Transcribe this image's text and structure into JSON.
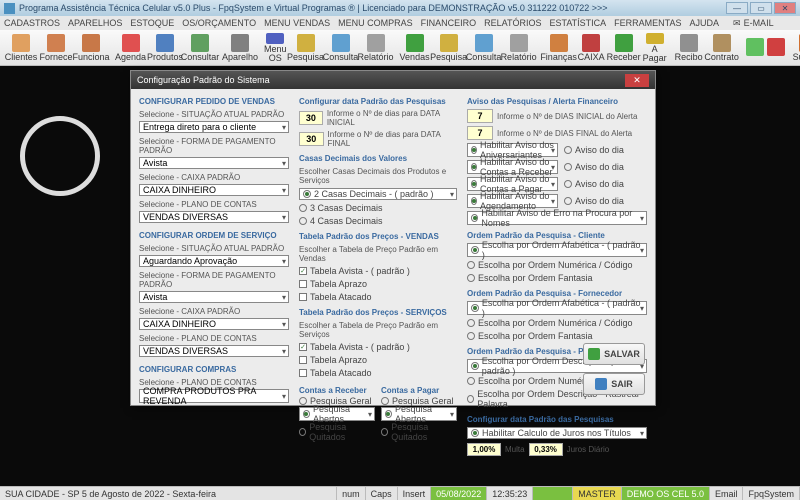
{
  "title": "Programa Assistência Técnica Celular v5.0 Plus - FpqSystem e Virtual Programas ® | Licenciado para  DEMONSTRAÇÃO v5.0 311222 010722 >>>",
  "menu": [
    "CADASTROS",
    "APARELHOS",
    "ESTOQUE",
    "OS/ORÇAMENTO",
    "MENU VENDAS",
    "MENU COMPRAS",
    "FINANCEIRO",
    "RELATÓRIOS",
    "ESTATÍSTICA",
    "FERRAMENTAS",
    "AJUDA"
  ],
  "email": "E-MAIL",
  "toolbar": [
    {
      "l": "Clientes",
      "c": "#e0a060"
    },
    {
      "l": "Fornece",
      "c": "#d08050"
    },
    {
      "l": "Funciona",
      "c": "#c87848"
    },
    {
      "l": "Agenda",
      "c": "#e05050"
    },
    {
      "l": "Produtos",
      "c": "#5080c0"
    },
    {
      "l": "Consultar",
      "c": "#60a060"
    },
    {
      "l": "Aparelho",
      "c": "#808080"
    },
    {
      "l": "Menu OS",
      "c": "#5060c0"
    },
    {
      "l": "Pesquisa",
      "c": "#d0b040"
    },
    {
      "l": "Consulta",
      "c": "#60a0d0"
    },
    {
      "l": "Relatório",
      "c": "#a0a0a0"
    },
    {
      "l": "Vendas",
      "c": "#40a040"
    },
    {
      "l": "Pesquisa",
      "c": "#d0b040"
    },
    {
      "l": "Consulta",
      "c": "#60a0d0"
    },
    {
      "l": "Relatório",
      "c": "#a0a0a0"
    },
    {
      "l": "Finanças",
      "c": "#d08040"
    },
    {
      "l": "CAIXA",
      "c": "#c04040"
    },
    {
      "l": "Receber",
      "c": "#40a040"
    },
    {
      "l": "A Pagar",
      "c": "#d0b030"
    },
    {
      "l": "Recibo",
      "c": "#909090"
    },
    {
      "l": "Contrato",
      "c": "#b09060"
    },
    {
      "l": "",
      "c": "#60c060"
    },
    {
      "l": "",
      "c": "#d04040"
    },
    {
      "l": "Suporte",
      "c": "#d07030"
    }
  ],
  "dlg": {
    "title": "Configuração Padrão do Sistema",
    "vendas": {
      "title": "CONFIGURAR PEDIDO DE VENDAS",
      "sit_lbl": "Selecione - SITUAÇÃO ATUAL PADRÃO",
      "sit": "Entrega direto para o cliente",
      "pag_lbl": "Selecione - FORMA DE PAGAMENTO PADRÃO",
      "pag": "Avista",
      "cx_lbl": "Selecione - CAIXA PADRÃO",
      "cx": "CAIXA DINHEIRO",
      "pc_lbl": "Selecione - PLANO DE CONTAS",
      "pc": "VENDAS DIVERSAS"
    },
    "os": {
      "title": "CONFIGURAR ORDEM DE SERVIÇO",
      "sit_lbl": "Selecione - SITUAÇÃO ATUAL PADRÃO",
      "sit": "Aguardando Aprovação",
      "pag_lbl": "Selecione - FORMA DE PAGAMENTO PADRÃO",
      "pag": "Avista",
      "cx_lbl": "Selecione - CAIXA PADRÃO",
      "cx": "CAIXA DINHEIRO",
      "pc_lbl": "Selecione - PLANO DE CONTAS",
      "pc": "VENDAS DIVERSAS"
    },
    "compras": {
      "title": "CONFIGURAR COMPRAS",
      "pc_lbl": "Selecione - PLANO DE CONTAS",
      "pc": "COMPRA PRODUTOS PRA REVENDA"
    },
    "pesq": {
      "title": "Configurar data Padrão das Pesquisas",
      "n1": "30",
      "l1": "Informe o Nº de dias para DATA INICIAL",
      "n2": "30",
      "l2": "Informe o Nº de dias para DATA FINAL"
    },
    "casas": {
      "title": "Casas Decimais dos Valores",
      "sub": "Escolher Casas Decimais dos Produtos e Serviços",
      "o1": "2 Casas Decimais - ( padrão )",
      "o2": "3 Casas Decimais",
      "o3": "4 Casas Decimais"
    },
    "tpv": {
      "title": "Tabela Padrão dos Preços - VENDAS",
      "sub": "Escolher a Tabela de Preço Padrão em Vendas",
      "o1": "Tabela Avista - ( padrão )",
      "o2": "Tabela Aprazo",
      "o3": "Tabela Atacado"
    },
    "tps": {
      "title": "Tabela Padrão dos Preços - SERVIÇOS",
      "sub": "Escolher a Tabela de Preço Padrão em Serviços",
      "o1": "Tabela Avista - ( padrão )",
      "o2": "Tabela Aprazo",
      "o3": "Tabela Atacado"
    },
    "contas": {
      "rec": "Contas a Receber",
      "pag": "Contas a Pagar",
      "o1": "Pesquisa Geral",
      "o2": "Pesquisa Abertos",
      "o3": "Pesquisa Quitados"
    },
    "aviso": {
      "title": "Aviso das Pesquisas / Alerta Financeiro",
      "n1": "7",
      "l1": "Informe o Nº de DIAS INICIAL do Alerta",
      "n2": "7",
      "l2": "Informe o Nº de DIAS FINAL do Alerta",
      "r1": "Habilitar Aviso dos Aniversariantes",
      "r1b": "Aviso do dia",
      "r2": "Habilitar Aviso do Contas a Receber",
      "r2b": "Aviso do dia",
      "r3": "Habilitar Aviso do Contas a Pagar",
      "r3b": "Aviso do dia",
      "r4": "Habilitar Aviso do Agendamento",
      "r4b": "Aviso do dia",
      "r5": "Habilitar Aviso de Erro na Procura por Nomes"
    },
    "ordcli": {
      "title": "Ordem Padrão da Pesquisa - Cliente",
      "o1": "Escolha por Ordem Afabética - ( padrão )",
      "o2": "Escolha por Ordem Numérica / Código",
      "o3": "Escolha por Ordem Fantasia"
    },
    "ordfor": {
      "title": "Ordem Padrão da Pesquisa - Fornecedor",
      "o1": "Escolha por Ordem Afabética - ( padrão )",
      "o2": "Escolha por Ordem Numérica / Código",
      "o3": "Escolha por Ordem Fantasia"
    },
    "ordpro": {
      "title": "Ordem Padrão da Pesquisa - Produtos",
      "o1": "Escolha por Ordem Descrição - ( padrão )",
      "o2": "Escolha por Ordem Numérica / Código",
      "o3": "Escolha por Ordem Descrição - Rastrear Palavra"
    },
    "juros": {
      "title": "Configurar data Padrão das Pesquisas",
      "chk": "Habilitar Calculo de Juros nos Títulos",
      "p1": "1,00%",
      "ml": "Multa",
      "p2": "0,33%",
      "jl": "Juros Diário"
    },
    "save": "SALVAR",
    "exit": "SAIR"
  },
  "status": {
    "city": "SUA CIDADE - SP  5 de Agosto de 2022 - Sexta-feira",
    "num": "num",
    "caps": "Caps",
    "ins": "Insert",
    "date": "05/08/2022",
    "time": "12:35:23",
    "master": "MASTER",
    "demo": "DEMO OS CEL 5.0",
    "email": "Email",
    "fpq": "FpqSystem"
  }
}
